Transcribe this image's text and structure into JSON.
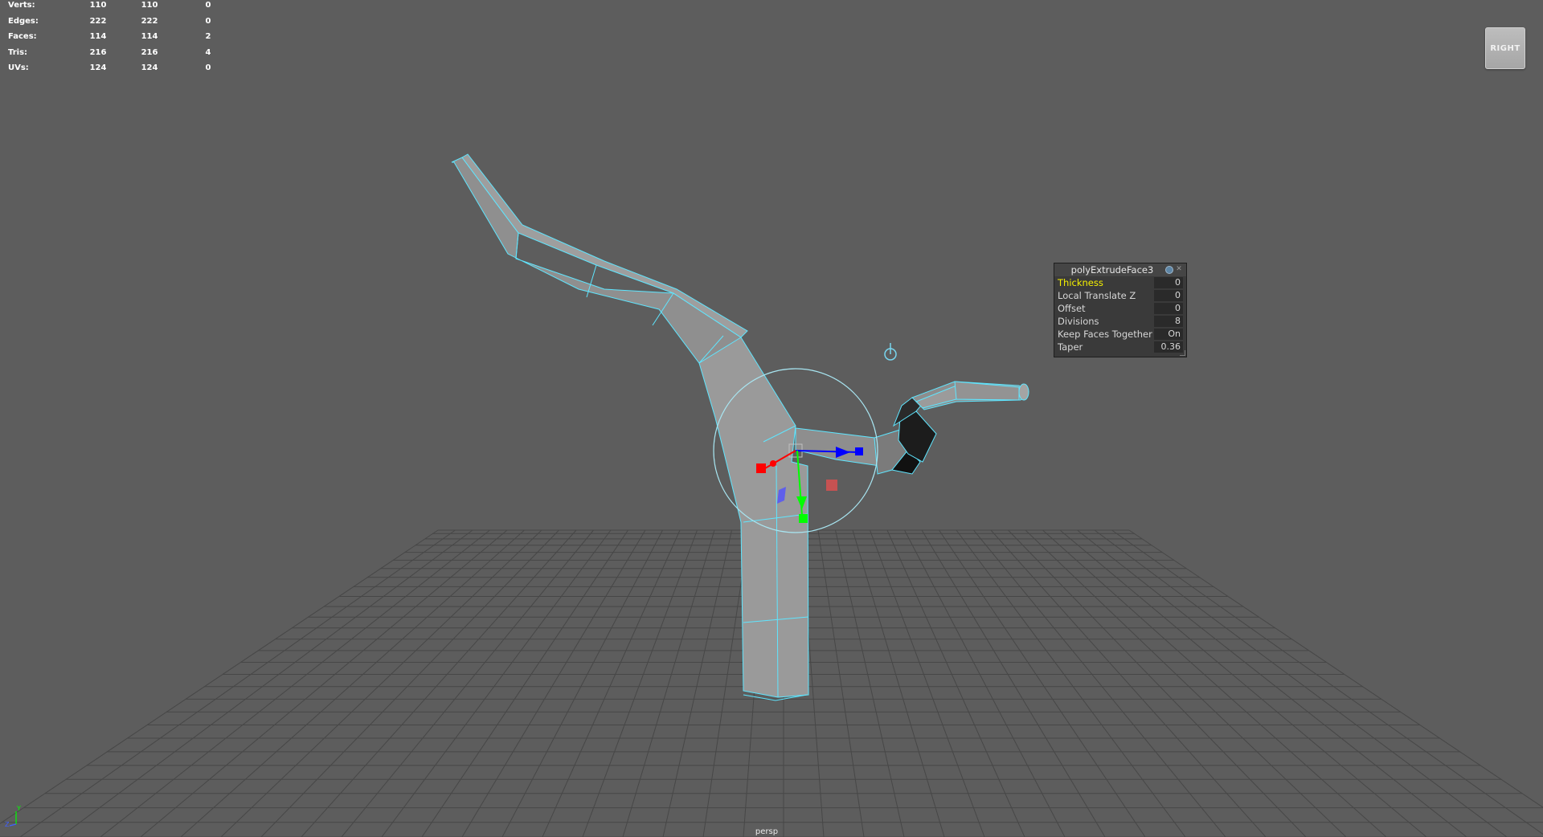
{
  "hud": {
    "rows": [
      {
        "label": "Verts:",
        "v1": "110",
        "v2": "110",
        "v3": "0"
      },
      {
        "label": "Edges:",
        "v1": "222",
        "v2": "222",
        "v3": "0"
      },
      {
        "label": "Faces:",
        "v1": "114",
        "v2": "114",
        "v3": "2"
      },
      {
        "label": "Tris:",
        "v1": "216",
        "v2": "216",
        "v3": "4"
      },
      {
        "label": "UVs:",
        "v1": "124",
        "v2": "124",
        "v3": "0"
      }
    ]
  },
  "viewcube": {
    "label": "RIGHT"
  },
  "editor": {
    "title": "polyExtrudeFace3",
    "settings_icon": "settings-icon",
    "close_icon": "close-icon",
    "attributes": [
      {
        "label": "Thickness",
        "value": "0",
        "highlight": true
      },
      {
        "label": "Local Translate Z",
        "value": "0"
      },
      {
        "label": "Offset",
        "value": "0"
      },
      {
        "label": "Divisions",
        "value": "8"
      },
      {
        "label": "Keep Faces Together",
        "value": "On"
      },
      {
        "label": "Taper",
        "value": "0.36"
      }
    ]
  },
  "camera": {
    "label": "persp"
  },
  "colors": {
    "background": "#5d5d5d",
    "grid": "#3f3f3f",
    "mesh_fill": "#9a9a9a",
    "wireframe": "#5fe6ff",
    "highlight_text": "#f5f000",
    "manip_x": "#ff0000",
    "manip_y": "#00ff00",
    "manip_z": "#0000ff"
  },
  "axis": {
    "y": "Y",
    "z": "Z"
  }
}
